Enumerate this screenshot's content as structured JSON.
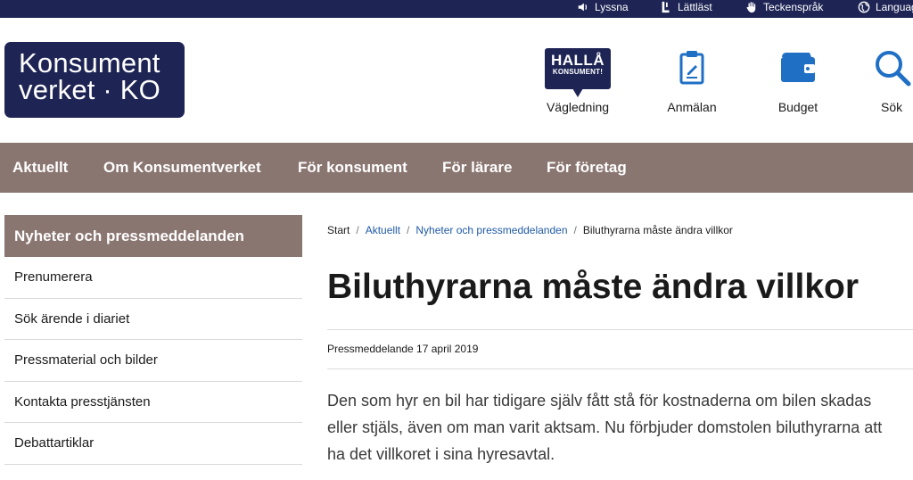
{
  "utility": {
    "listen": "Lyssna",
    "easy_read": "Lättläst",
    "sign_language": "Teckenspråk",
    "language": "Language"
  },
  "logo": {
    "line1": "Konsument",
    "line2": "verket · KO"
  },
  "header_links": {
    "halla_big": "HALLÅ",
    "halla_small": "KONSUMENT!",
    "guidance": "Vägledning",
    "report": "Anmälan",
    "budget": "Budget",
    "search": "Sök"
  },
  "nav": [
    "Aktuellt",
    "Om Konsumentverket",
    "För konsument",
    "För lärare",
    "För företag"
  ],
  "sidebar": {
    "heading": "Nyheter och pressmeddelanden",
    "items": [
      "Prenumerera",
      "Sök ärende i diariet",
      "Pressmaterial och bilder",
      "Kontakta presstjänsten",
      "Debattartiklar"
    ]
  },
  "breadcrumb": {
    "start": "Start",
    "current_section": "Aktuellt",
    "subsection": "Nyheter och pressmeddelanden",
    "page": "Biluthyrarna måste ändra villkor"
  },
  "article": {
    "title": "Biluthyrarna måste ändra villkor",
    "meta": "Pressmeddelande 17 april 2019",
    "lead_lines": [
      "Den som hyr en bil har tidigare själv fått stå för kostnaderna om bilen skadas",
      "eller stjäls, även om man varit aktsam. Nu förbjuder domstolen biluthyrarna att",
      "ha det villkoret i sina hyresavtal."
    ]
  },
  "colors": {
    "navy": "#1e2555",
    "nav_brown": "#8a7671",
    "link_blue": "#1f5aa6",
    "icon_blue": "#1f6fc5"
  }
}
